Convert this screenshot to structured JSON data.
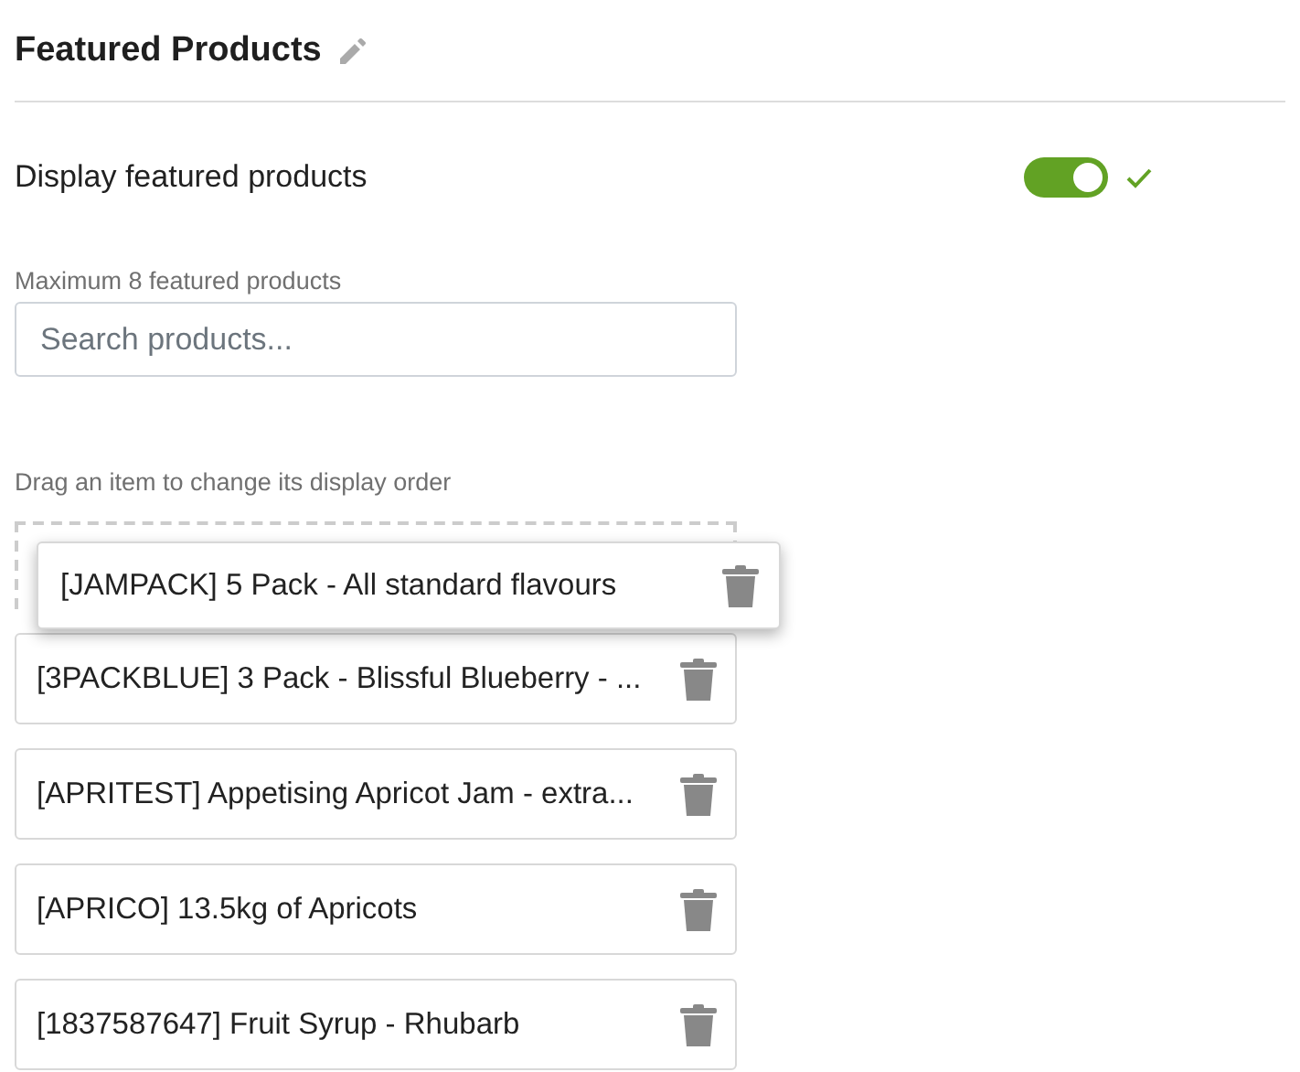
{
  "title": "Featured Products",
  "display": {
    "label": "Display featured products",
    "on": true
  },
  "search": {
    "label": "Maximum 8 featured products",
    "placeholder": "Search products..."
  },
  "hint": "Drag an item to change its display order",
  "dragging_item": {
    "text": "[JAMPACK] 5 Pack - All standard flavours"
  },
  "items": [
    {
      "text": "[3PACKBLUE] 3 Pack - Blissful Blueberry - ..."
    },
    {
      "text": "[APRITEST] Appetising Apricot Jam - extra..."
    },
    {
      "text": "[APRICO] 13.5kg of Apricots"
    },
    {
      "text": "[1837587647] Fruit Syrup - Rhubarb"
    }
  ]
}
